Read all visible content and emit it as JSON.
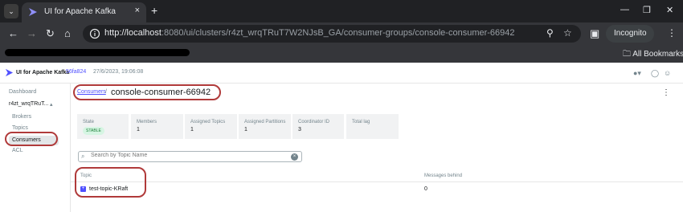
{
  "browser": {
    "tab_title": "UI for Apache Kafka",
    "url_host": "http://localhost",
    "url_rest": ":8080/ui/clusters/r4zt_wrqTRuT7W2NJsB_GA/consumer-groups/console-consumer-66942",
    "profile_label": "Incognito",
    "bookmarks_label": "All Bookmarks"
  },
  "app": {
    "name": "UI for Apache Kafka",
    "version": "56fa824",
    "build_date": "27/6/2023, 19:06:08"
  },
  "sidebar": {
    "dashboard": "Dashboard",
    "cluster": "r4zt_wrqTRuT...",
    "items": [
      "Brokers",
      "Topics",
      "Consumers",
      "ACL"
    ]
  },
  "breadcrumb": {
    "parent": "Consumers",
    "current": "console-consumer-66942"
  },
  "metrics": [
    {
      "label": "State",
      "value": "STABLE"
    },
    {
      "label": "Members",
      "value": "1"
    },
    {
      "label": "Assigned Topics",
      "value": "1"
    },
    {
      "label": "Assigned Partitions",
      "value": "1"
    },
    {
      "label": "Coordinator ID",
      "value": "3"
    },
    {
      "label": "Total lag",
      "value": ""
    }
  ],
  "search": {
    "placeholder": "Search by Topic Name"
  },
  "table": {
    "headers": [
      "Topic",
      "Messages behind"
    ],
    "rows": [
      {
        "topic": "test-topic-KRaft",
        "lag": "0"
      }
    ]
  }
}
